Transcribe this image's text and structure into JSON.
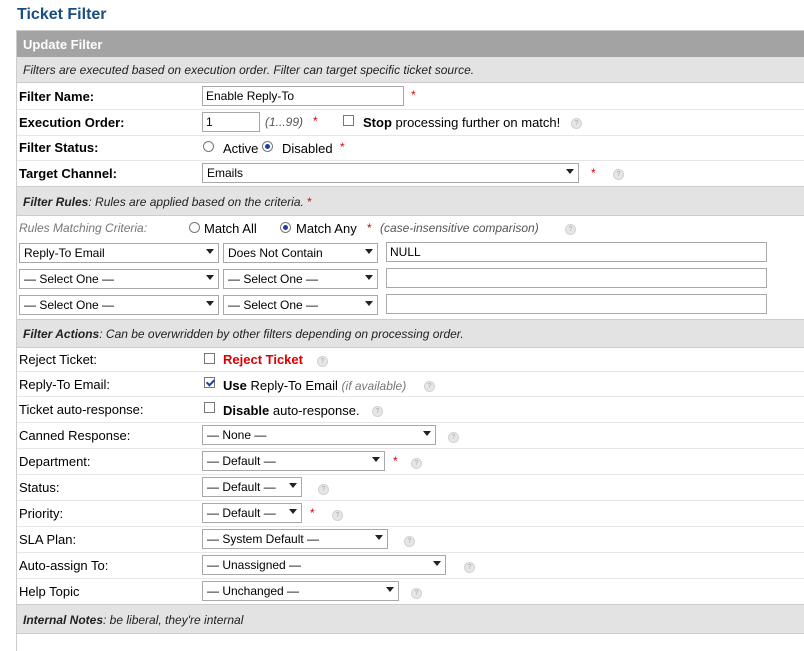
{
  "page_title": "Ticket Filter",
  "section": {
    "title": "Update Filter",
    "note": "Filters are executed based on execution order. Filter can target specific ticket source."
  },
  "fields": {
    "filter_name": {
      "label": "Filter Name:",
      "value": "Enable Reply-To"
    },
    "execution_order": {
      "label": "Execution Order:",
      "value": "1",
      "range_hint": "(1...99)",
      "stop_label_bold": "Stop",
      "stop_label_rest": "processing further on match!",
      "stop_checked": false
    },
    "filter_status": {
      "label": "Filter Status:",
      "active_label": "Active",
      "disabled_label": "Disabled",
      "selected": "Disabled"
    },
    "target_channel": {
      "label": "Target Channel:",
      "value": "Emails"
    }
  },
  "rules": {
    "header_bold": "Filter Rules",
    "header_rest": ": Rules are applied based on the criteria.",
    "criteria_label": "Rules Matching Criteria:",
    "match_all_label": "Match All",
    "match_any_label": "Match Any",
    "selected": "Match Any",
    "comparison_hint": "(case-insensitive comparison)",
    "rows": [
      {
        "what": "Reply-To Email",
        "how": "Does Not Contain",
        "val": "NULL"
      },
      {
        "what": "— Select One —",
        "how": "— Select One —",
        "val": ""
      },
      {
        "what": "— Select One —",
        "how": "— Select One —",
        "val": ""
      }
    ]
  },
  "actions": {
    "header_bold": "Filter Actions",
    "header_rest": ": Can be overwridden by other filters depending on processing order.",
    "reject": {
      "label": "Reject Ticket:",
      "check_label": "Reject Ticket",
      "checked": false
    },
    "reply_to": {
      "label": "Reply-To Email:",
      "bold": "Use",
      "rest": "Reply-To Email",
      "hint": "(if available)",
      "checked": true
    },
    "auto_response": {
      "label": "Ticket auto-response:",
      "bold": "Disable",
      "rest": "auto-response.",
      "checked": false
    },
    "canned": {
      "label": "Canned Response:",
      "value": "— None —"
    },
    "department": {
      "label": "Department:",
      "value": "— Default —"
    },
    "status": {
      "label": "Status:",
      "value": "— Default —"
    },
    "priority": {
      "label": "Priority:",
      "value": "— Default —"
    },
    "sla": {
      "label": "SLA Plan:",
      "value": "— System Default —"
    },
    "assign": {
      "label": "Auto-assign To:",
      "value": "— Unassigned —"
    },
    "topic": {
      "label": "Help Topic",
      "value": "— Unchanged —"
    }
  },
  "notes": {
    "header_bold": "Internal Notes",
    "header_rest": ": be liberal, they're internal"
  },
  "required_mark": "*",
  "help_glyph": "?",
  "colors": {
    "title": "#184E81",
    "section_header": "#a3a3a3",
    "sub_header": "#e3e3e3",
    "required": "#dd0000"
  }
}
